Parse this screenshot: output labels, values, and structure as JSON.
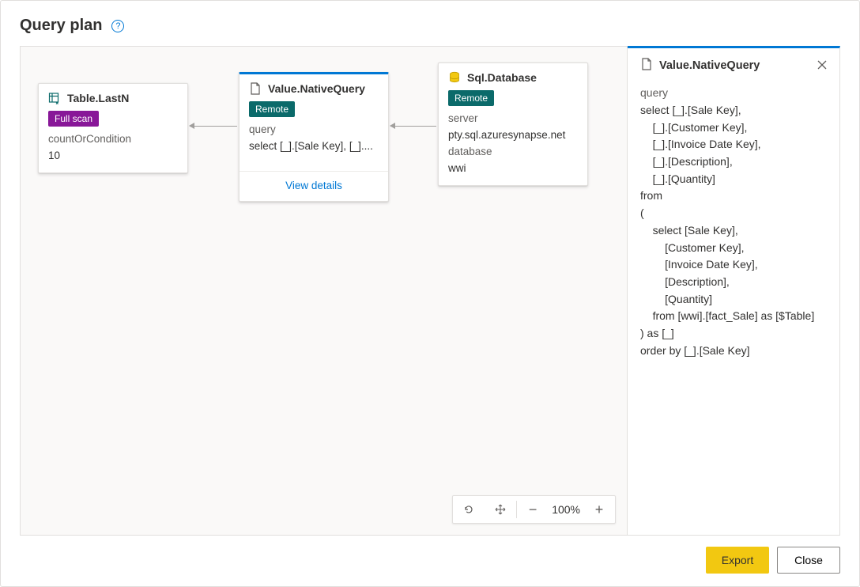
{
  "header": {
    "title": "Query plan"
  },
  "canvas": {
    "nodes": {
      "lastn": {
        "title": "Table.LastN",
        "badge": "Full scan",
        "param_label": "countOrCondition",
        "param_value": "10"
      },
      "nativequery": {
        "title": "Value.NativeQuery",
        "badge": "Remote",
        "param_label": "query",
        "param_value": "select [_].[Sale Key], [_]....",
        "view_details": "View details"
      },
      "sqldb": {
        "title": "Sql.Database",
        "badge": "Remote",
        "server_label": "server",
        "server_value": "pty.sql.azuresynapse.net",
        "database_label": "database",
        "database_value": "wwi"
      }
    },
    "zoom": {
      "value": "100%"
    }
  },
  "details": {
    "title": "Value.NativeQuery",
    "param_label": "query",
    "query_text": "select [_].[Sale Key],\n    [_].[Customer Key],\n    [_].[Invoice Date Key],\n    [_].[Description],\n    [_].[Quantity]\nfrom \n(\n    select [Sale Key],\n        [Customer Key],\n        [Invoice Date Key],\n        [Description],\n        [Quantity]\n    from [wwi].[fact_Sale] as [$Table]\n) as [_]\norder by [_].[Sale Key]"
  },
  "footer": {
    "export_label": "Export",
    "close_label": "Close"
  }
}
